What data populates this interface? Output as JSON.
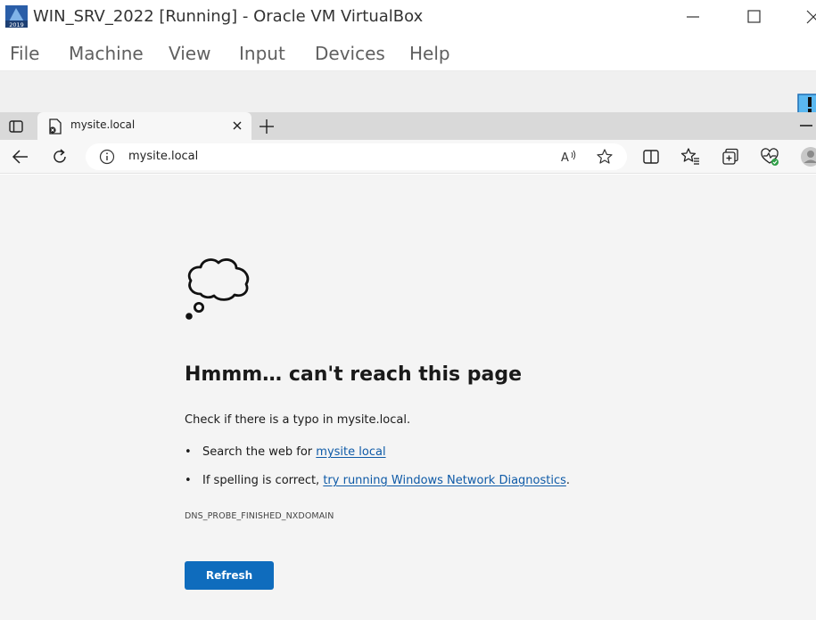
{
  "vbox": {
    "title": "WIN_SRV_2022 [Running] - Oracle VM VirtualBox",
    "app_icon_text": "2019",
    "menu": [
      "File",
      "Machine",
      "View",
      "Input",
      "Devices",
      "Help"
    ]
  },
  "browser": {
    "tab": {
      "title": "mysite.local"
    },
    "address": {
      "url": "mysite.local"
    },
    "toolbar_icons": [
      "back-icon",
      "reload-icon",
      "site-info-icon",
      "read-aloud-icon",
      "favorite-star-icon",
      "split-screen-icon",
      "favorites-icon",
      "collections-icon",
      "browser-essentials-icon",
      "profile-icon"
    ]
  },
  "error_page": {
    "heading": "Hmmm… can't reach this page",
    "description": "Check if there is a typo in mysite.local.",
    "bullets": [
      {
        "prefix": "Search the web for ",
        "link": "mysite local",
        "suffix": ""
      },
      {
        "prefix": "If spelling is correct, ",
        "link": "try running Windows Network Diagnostics",
        "suffix": "."
      }
    ],
    "error_code": "DNS_PROBE_FINISHED_NXDOMAIN",
    "refresh_label": "Refresh"
  },
  "colors": {
    "accent_button": "#0f6cbd",
    "link": "#0e5aa7",
    "page_background": "#f4f4f4"
  }
}
